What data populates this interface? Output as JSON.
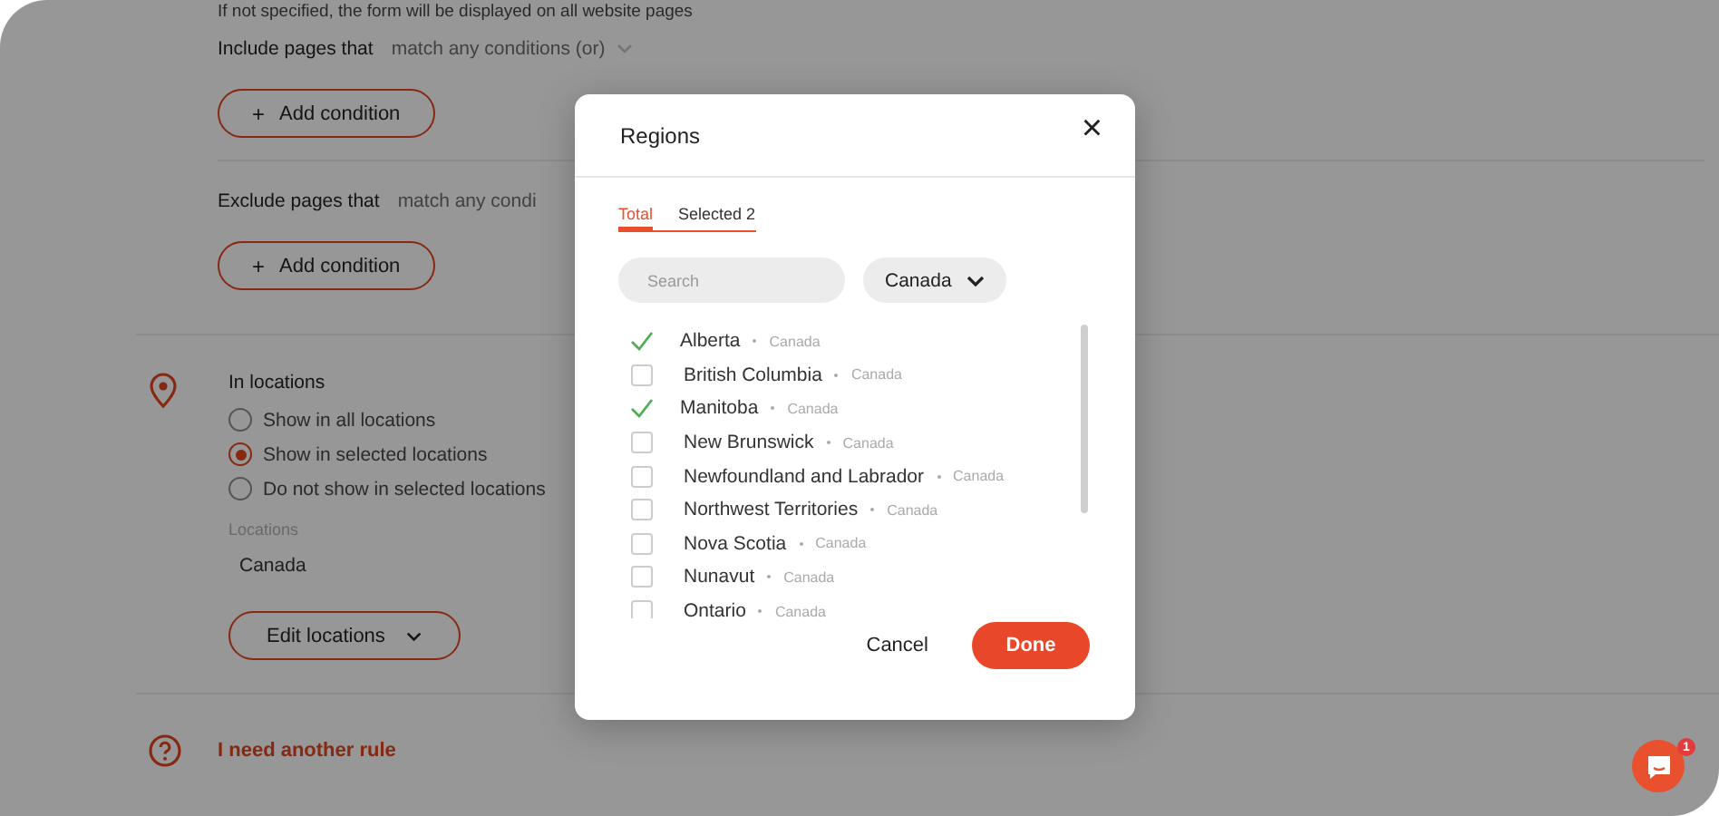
{
  "page": {
    "note": "If not specified, the form will be displayed on all website pages",
    "include": {
      "label": "Include pages that",
      "mode": "match any conditions (or)",
      "icon": "+",
      "button": "Add condition"
    },
    "exclude": {
      "label": "Exclude pages that",
      "mode": "match any condi",
      "icon": "+",
      "button": "Add condition"
    },
    "locations": {
      "title": "In locations",
      "options": [
        {
          "label": "Show in all locations",
          "selected": false
        },
        {
          "label": "Show in selected locations",
          "selected": true
        },
        {
          "label": "Do not show in selected locations",
          "selected": false
        }
      ],
      "field_label": "Locations",
      "value": "Canada",
      "button": "Edit locations"
    },
    "another_rule": "I need another rule"
  },
  "dialog": {
    "title": "Regions",
    "close": "×",
    "tabs": [
      {
        "label": "Total",
        "selected": true
      },
      {
        "label": "Selected 2",
        "selected": false
      }
    ],
    "search": {
      "placeholder": "Search"
    },
    "country": "Canada",
    "regions": [
      {
        "name": "Alberta",
        "country": "Canada",
        "checked": true
      },
      {
        "name": "British Columbia",
        "country": "Canada",
        "checked": false
      },
      {
        "name": "Manitoba",
        "country": "Canada",
        "checked": true
      },
      {
        "name": "New Brunswick",
        "country": "Canada",
        "checked": false
      },
      {
        "name": "Newfoundland and Labrador",
        "country": "Canada",
        "checked": false
      },
      {
        "name": "Northwest Territories",
        "country": "Canada",
        "checked": false
      },
      {
        "name": "Nova Scotia",
        "country": "Canada",
        "checked": false
      },
      {
        "name": "Nunavut",
        "country": "Canada",
        "checked": false
      },
      {
        "name": "Ontario",
        "country": "Canada",
        "checked": false
      }
    ],
    "buttons": {
      "cancel": "Cancel",
      "done": "Done"
    }
  },
  "chat": {
    "badge": "1"
  }
}
